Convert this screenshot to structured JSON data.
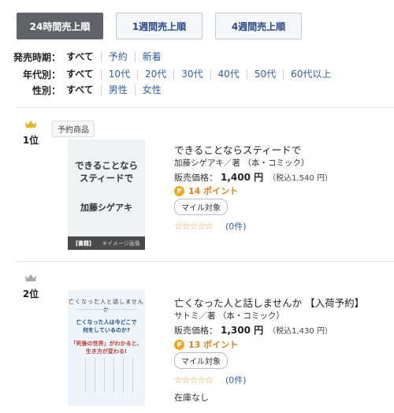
{
  "tabs": [
    {
      "label": "24時間売上順",
      "active": true
    },
    {
      "label": "1週間売上順",
      "active": false
    },
    {
      "label": "4週間売上順",
      "active": false
    }
  ],
  "filters": {
    "release": {
      "label": "発売時期：",
      "options": [
        "すべて",
        "予約",
        "新着"
      ]
    },
    "age": {
      "label": "年代別：",
      "options": [
        "すべて",
        "10代",
        "20代",
        "30代",
        "40代",
        "50代",
        "60代以上"
      ]
    },
    "gender": {
      "label": "性別：",
      "options": [
        "すべて",
        "男性",
        "女性"
      ]
    }
  },
  "items": [
    {
      "rank": "1位",
      "crown_color": "#e6b422",
      "badge": "予約商品",
      "cover": {
        "title_line1": "できることなら",
        "title_line2": "スティードで",
        "author": "加藤シゲアキ",
        "bar_label": "【書籍】",
        "bar_note": "※イメージ画像"
      },
      "title": "できることならスティードで",
      "author": "加藤シゲアキ／著 （本・コミック）",
      "price_label": "販売価格：",
      "price": "1,400 円",
      "tax": "（税込1,540 円）",
      "points": "14 ポイント",
      "mile": "マイル対象",
      "stars": "☆☆☆☆☆",
      "reviews": "(0件)"
    },
    {
      "rank": "2位",
      "crown_color": "#a9a9a9",
      "cover": {
        "title": "亡くなった人と話しませんか",
        "copy1_line1": "亡くなった人は今どこで",
        "copy1_line2": "何をしているのか?",
        "copy2_line1": "「死後の世界」がわかると、",
        "copy2_line2": "生き方が変わる!"
      },
      "title": "亡くなった人と話しませんか 【入荷予約】",
      "author": "サトミ／著 （本・コミック）",
      "price_label": "販売価格：",
      "price": "1,300 円",
      "tax": "（税込1,430 円）",
      "points": "13 ポイント",
      "mile": "マイル対象",
      "stars": "☆☆☆☆☆",
      "reviews": "(0件)",
      "stock": "在庫なし"
    }
  ]
}
